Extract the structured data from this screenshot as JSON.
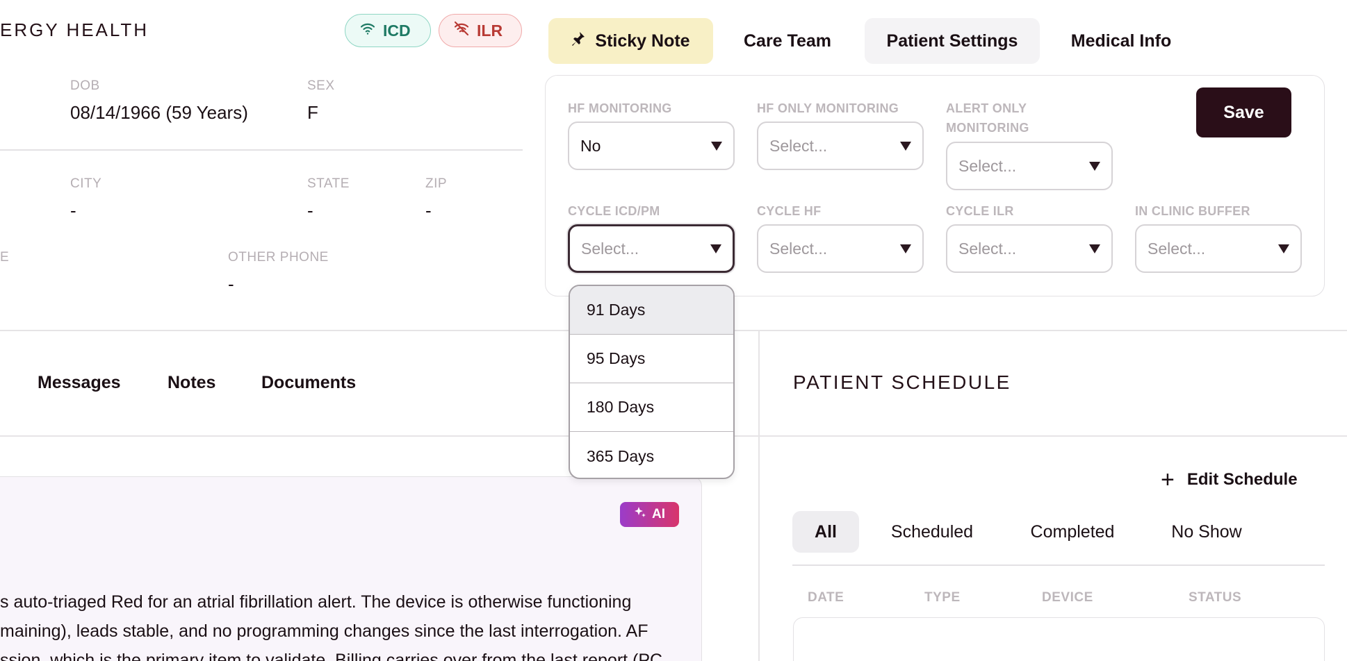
{
  "header": {
    "org_title": "ERGY HEALTH",
    "badges": [
      {
        "label": "ICD",
        "icon": "wifi-icon",
        "color": "#1e7a64"
      },
      {
        "label": "ILR",
        "icon": "wifi-off-icon",
        "color": "#b83a34"
      }
    ]
  },
  "demographics": {
    "dob_label": "DOB",
    "dob_value": "08/14/1966 (59 Years)",
    "sex_label": "SEX",
    "sex_value": "F",
    "city_label": "CITY",
    "city_value": "-",
    "state_label": "STATE",
    "state_value": "-",
    "zip_label": "ZIP",
    "zip_value": "-",
    "phone_label_partial": "E",
    "other_phone_label": "OTHER PHONE",
    "other_phone_value": "-"
  },
  "top_tabs": {
    "sticky_note": "Sticky Note",
    "care_team": "Care Team",
    "patient_settings": "Patient Settings",
    "medical_info": "Medical Info"
  },
  "settings": {
    "save_label": "Save",
    "hf_monitoring": {
      "label": "HF MONITORING",
      "value": "No"
    },
    "hf_only_monitoring": {
      "label": "HF ONLY MONITORING",
      "placeholder": "Select..."
    },
    "alert_only_monitoring": {
      "label_line1": "ALERT ONLY",
      "label_line2": "MONITORING",
      "placeholder": "Select..."
    },
    "cycle_icd_pm": {
      "label": "CYCLE ICD/PM",
      "placeholder": "Select..."
    },
    "cycle_hf": {
      "label": "CYCLE HF",
      "placeholder": "Select..."
    },
    "cycle_ilr": {
      "label": "CYCLE ILR",
      "placeholder": "Select..."
    },
    "in_clinic_buffer": {
      "label": "IN CLINIC BUFFER",
      "placeholder": "Select..."
    }
  },
  "dropdown_options": [
    "91 Days",
    "95 Days",
    "180 Days",
    "365 Days"
  ],
  "lower_tabs": {
    "messages": "Messages",
    "notes": "Notes",
    "documents": "Documents"
  },
  "summary": {
    "ai_label": "AI",
    "lines": [
      "s auto-triaged Red for an atrial fibrillation alert. The device is otherwise functioning",
      "maining), leads stable, and no programming changes since the last interrogation. AF",
      "ssion, which is the primary item to validate. Billing carries over from the last report (PC"
    ]
  },
  "schedule": {
    "title": "PATIENT SCHEDULE",
    "edit_label": "Edit Schedule",
    "filters": [
      "All",
      "Scheduled",
      "Completed",
      "No Show"
    ],
    "columns": [
      "DATE",
      "TYPE",
      "DEVICE",
      "STATUS"
    ]
  }
}
